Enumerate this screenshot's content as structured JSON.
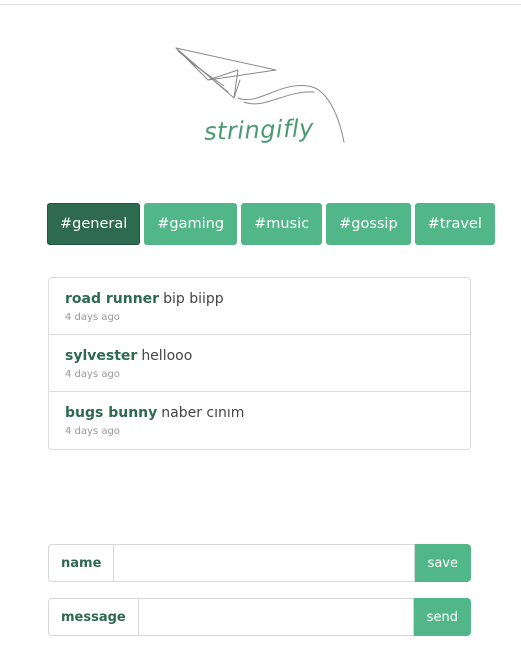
{
  "app": {
    "logo_text": "stringifly"
  },
  "channels": [
    {
      "label": "#general",
      "active": true
    },
    {
      "label": "#gaming",
      "active": false
    },
    {
      "label": "#music",
      "active": false
    },
    {
      "label": "#gossip",
      "active": false
    },
    {
      "label": "#travel",
      "active": false
    }
  ],
  "messages": [
    {
      "author": "road runner",
      "text": "bip biipp",
      "time": "4 days ago"
    },
    {
      "author": "sylvester",
      "text": "hellooo",
      "time": "4 days ago"
    },
    {
      "author": "bugs bunny",
      "text": "naber cınım",
      "time": "4 days ago"
    }
  ],
  "name_form": {
    "label": "name",
    "value": "",
    "button": "save"
  },
  "message_form": {
    "label": "message",
    "value": "",
    "button": "send"
  },
  "colors": {
    "accent": "#52b788",
    "accent_dark": "#2d6a4f"
  }
}
